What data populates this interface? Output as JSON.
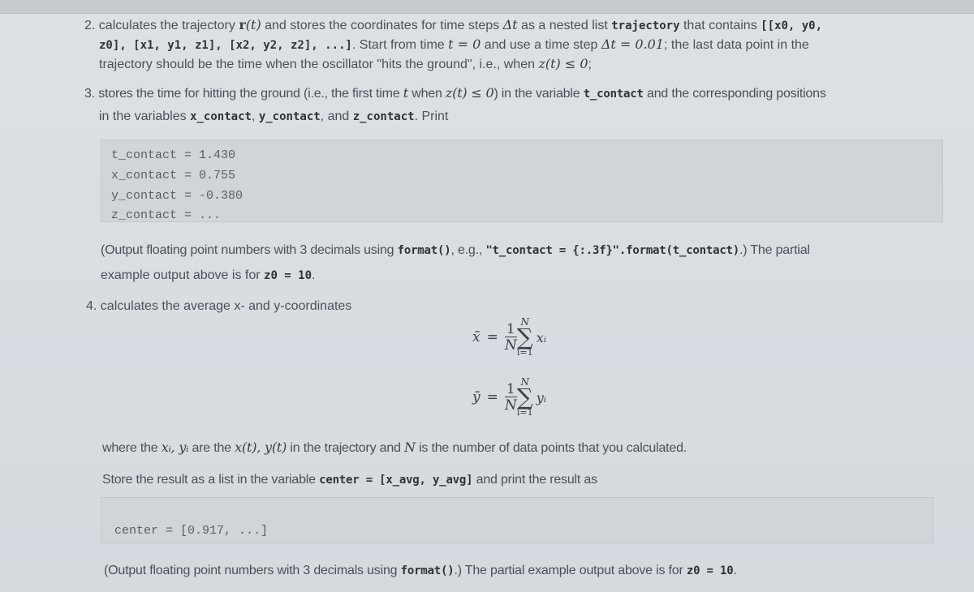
{
  "item2": {
    "number": "2.",
    "line1_a": "calculates the trajectory ",
    "line1_math_r": "r",
    "line1_math_t": "(t)",
    "line1_b": " and stores the coordinates for time steps ",
    "line1_math_dt": "Δt",
    "line1_c": " as a nested list ",
    "line1_code_trajectory": "trajectory",
    "line1_d": " that contains ",
    "line1_code_list_start": "[[x0, y0,",
    "line2_code_list": "z0], [x1, y1, z1], [x2, y2, z2], ...]",
    "line2_a": ". Start from time ",
    "line2_math_t0": "t = 0",
    "line2_b": " and use a time step ",
    "line2_math_dt": "Δt = 0.01",
    "line2_c": "; the last data point in the",
    "line3_a": "trajectory should be the time when the oscillator \"hits the ground\", i.e., when ",
    "line3_math": "z(t) ≤ 0",
    "line3_b": ";"
  },
  "item3": {
    "number": "3.",
    "line1_a": "stores the time for hitting the ground (i.e., the first time ",
    "line1_math_t": "t",
    "line1_b": " when ",
    "line1_math_z": "z(t) ≤ 0",
    "line1_c": ") in the variable ",
    "line1_code": "t_contact",
    "line1_d": " and the corresponding positions",
    "line2_a": "in the variables ",
    "line2_code_x": "x_contact",
    "line2_sep1": ", ",
    "line2_code_y": "y_contact",
    "line2_sep2": ", and ",
    "line2_code_z": "z_contact",
    "line2_b": ". Print"
  },
  "output_example_1": {
    "lines": [
      "t_contact = 1.430",
      "x_contact = 0.755",
      "y_contact = -0.380",
      "z_contact = ..."
    ]
  },
  "note1": {
    "line1_a": "(Output floating point numbers with 3 decimals using ",
    "line1_code_format": "format()",
    "line1_b": ", e.g., ",
    "line1_code_example": "\"t_contact = {:.3f}\".format(t_contact)",
    "line1_c": ".) The partial",
    "line2_a": "example output above is for ",
    "line2_code": "z0 = 10",
    "line2_b": "."
  },
  "item4": {
    "number": "4.",
    "text": "calculates the average x- and y-coordinates"
  },
  "formulas": {
    "x_lhs": "x̄",
    "y_lhs": "ȳ",
    "equals": "=",
    "numerator": "1",
    "denominator": "N",
    "sum_upper": "N",
    "sum_symbol": "∑",
    "sum_lower": "i=1",
    "x_term": "xᵢ",
    "y_term": "yᵢ"
  },
  "explain": {
    "line1_a": "where the ",
    "line1_math_xy": "xᵢ, yᵢ",
    "line1_b": " are the ",
    "line1_math_xt": "x(t), y(t)",
    "line1_c": " in the trajectory and ",
    "line1_math_N": "N",
    "line1_d": " is the number of data points that you calculated.",
    "line2_a": "Store the result as a list in the variable ",
    "line2_code": "center = [x_avg, y_avg]",
    "line2_b": " and print the result as"
  },
  "output_example_2": {
    "line": "center = [0.917, ...]"
  },
  "note2": {
    "a": "(Output floating point numbers with 3 decimals using ",
    "code_format": "format()",
    "b": ".) The partial example output above is for ",
    "code_z0": "z0 = 10",
    "c": "."
  }
}
